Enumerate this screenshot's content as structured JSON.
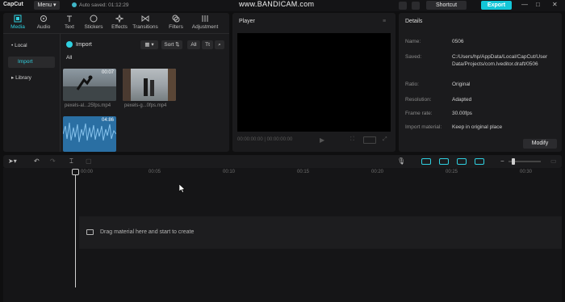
{
  "app": {
    "logo": "CapCut",
    "menu": "Menu",
    "autosave": "Auto saved: 01:12:29",
    "watermark": "www.BANDICAM.com",
    "shortcut": "Shortcut",
    "export": "Export"
  },
  "tabs": [
    {
      "label": "Media",
      "icon": "media-icon"
    },
    {
      "label": "Audio",
      "icon": "audio-icon"
    },
    {
      "label": "Text",
      "icon": "text-icon"
    },
    {
      "label": "Stickers",
      "icon": "stickers-icon"
    },
    {
      "label": "Effects",
      "icon": "effects-icon"
    },
    {
      "label": "Transitions",
      "icon": "transitions-icon"
    },
    {
      "label": "Filters",
      "icon": "filters-icon"
    },
    {
      "label": "Adjustment",
      "icon": "adjustment-icon"
    }
  ],
  "nav": {
    "local": "• Local",
    "import": "Import",
    "library": "▸ Library"
  },
  "media_toolbar": {
    "import": "Import",
    "sort": "Sort",
    "all": "All"
  },
  "media_section": "All",
  "media_items": [
    {
      "name": "pexels-al...25fps.mp4",
      "duration": "00:07"
    },
    {
      "name": "pexels-g...0fps.mp4",
      "duration": ""
    },
    {
      "name": "",
      "duration": "04:86"
    }
  ],
  "player": {
    "title": "Player",
    "timecode": "00:00:00:00 | 00:00:00:00"
  },
  "details": {
    "title": "Details",
    "rows": [
      {
        "key": "Name:",
        "value": "0506"
      },
      {
        "key": "Saved:",
        "value": "C:/Users/hp/AppData/Local/CapCut/User Data/Projects/com.lveditor.draft/0506"
      },
      {
        "key": "Ratio:",
        "value": "Original"
      },
      {
        "key": "Resolution:",
        "value": "Adapted"
      },
      {
        "key": "Frame rate:",
        "value": "30.00fps"
      },
      {
        "key": "Import material:",
        "value": "Keep in original place"
      }
    ],
    "modify": "Modify"
  },
  "timeline": {
    "ticks": [
      "00:00",
      "00:05",
      "00:10",
      "00:15",
      "00:20",
      "00:25",
      "00:30"
    ],
    "drag_text": "Drag material here and start to create"
  },
  "colors": {
    "accent": "#13c6d8",
    "panel": "#1b1b1d",
    "bg": "#0f0f10"
  }
}
